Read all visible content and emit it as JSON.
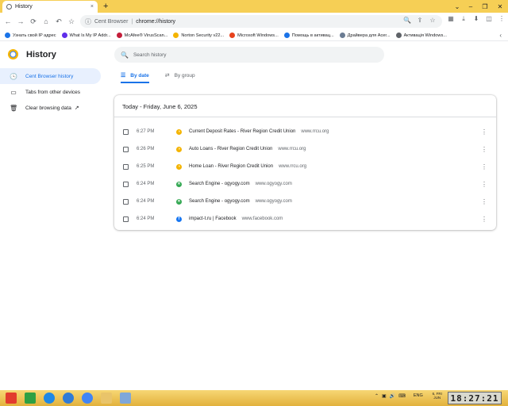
{
  "browser": {
    "tab_title": "History",
    "tab_close": "×",
    "new_tab": "+",
    "window_controls": [
      "⌄",
      "–",
      "❐",
      "✕"
    ],
    "nav_buttons": [
      "←",
      "→",
      "⟳",
      "⌂",
      "↶",
      "☆"
    ],
    "address": {
      "host": "Cent Browser",
      "separator": "|",
      "url": "chrome://history"
    },
    "omni_icons": [
      "🔍",
      "⇪",
      "☆"
    ],
    "right_buttons": [
      "▦",
      "⤓",
      "⬇",
      "◫",
      "⋮"
    ],
    "bookmarks": [
      {
        "label": "Узнать свой IP адрес",
        "color": "#1a73e8"
      },
      {
        "label": "What Is My IP Addr...",
        "color": "#5f2eea"
      },
      {
        "label": "McAfee® VirusScan...",
        "color": "#c41e3a"
      },
      {
        "label": "Norton Security v22...",
        "color": "#f4b400"
      },
      {
        "label": "Microsoft Windows...",
        "color": "#e8421c"
      },
      {
        "label": "Помощь в активац...",
        "color": "#1a73e8"
      },
      {
        "label": "Драйвера для Acer...",
        "color": "#6b7c93"
      },
      {
        "label": "Активація Windows...",
        "color": "#5f6368"
      }
    ],
    "bookmarks_more": "‹"
  },
  "history": {
    "title": "History",
    "search_placeholder": "Search history",
    "nav": [
      {
        "label": "Cent Browser history",
        "icon": "clock-icon",
        "glyph": "🕓",
        "active": true
      },
      {
        "label": "Tabs from other devices",
        "icon": "devices-icon",
        "glyph": "▭",
        "active": false
      },
      {
        "label": "Clear browsing data",
        "icon": "trash-icon",
        "glyph": "🗑",
        "active": false,
        "ext": "↗"
      }
    ],
    "view_tabs": [
      {
        "label": "By date",
        "glyph": "☰",
        "active": true
      },
      {
        "label": "By group",
        "glyph": "⇄",
        "active": false
      }
    ],
    "day_header": "Today - Friday, June 6, 2025",
    "entries": [
      {
        "time": "6:27 PM",
        "title": "Current Deposit Rates - River Region Credit Union",
        "domain": "www.rrcu.org",
        "fav_color": "#f4b400",
        "fav_glyph": "◑"
      },
      {
        "time": "6:26 PM",
        "title": "Auto Loans - River Region Credit Union",
        "domain": "www.rrcu.org",
        "fav_color": "#f4b400",
        "fav_glyph": "◑"
      },
      {
        "time": "6:25 PM",
        "title": "Home Loan - River Region Credit Union",
        "domain": "www.rrcu.org",
        "fav_color": "#f4b400",
        "fav_glyph": "◑"
      },
      {
        "time": "6:24 PM",
        "title": "Search Engine - ogyogy.com",
        "domain": "www.ogyogy.com",
        "fav_color": "#34a853",
        "fav_glyph": "✕"
      },
      {
        "time": "6:24 PM",
        "title": "Search Engine - ogyogy.com",
        "domain": "www.ogyogy.com",
        "fav_color": "#34a853",
        "fav_glyph": "✕"
      },
      {
        "time": "6:24 PM",
        "title": "impact-t.ru | Facebook",
        "domain": "www.facebook.com",
        "fav_color": "#1877f2",
        "fav_glyph": "f"
      }
    ],
    "kebab": "⋮"
  },
  "taskbar": {
    "apps": [
      {
        "name": "start-button",
        "color": "#e23b2e"
      },
      {
        "name": "app-green",
        "color": "#2ea043"
      },
      {
        "name": "edge-icon",
        "color": "#1e88e5"
      },
      {
        "name": "app-blue-ring",
        "color": "#2f7bd6"
      },
      {
        "name": "cent-browser-icon",
        "color": "#4285f4"
      },
      {
        "name": "file-explorer-icon",
        "color": "#e9c46a"
      },
      {
        "name": "app-window",
        "color": "#7fa7d9"
      }
    ],
    "tray_icons": [
      "⌃",
      "▣",
      "🔊",
      "⌨"
    ],
    "language": "ENG",
    "date_line1": "6, FRI",
    "date_line2": "JUN",
    "clock": "18:27:21"
  }
}
